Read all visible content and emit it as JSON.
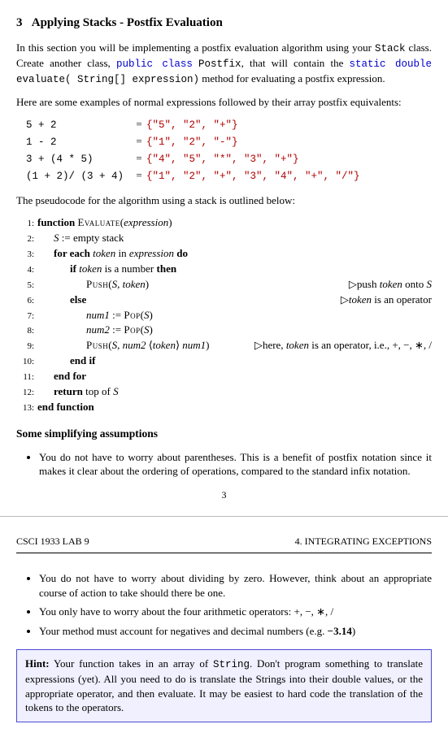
{
  "section": {
    "number": "3",
    "title": "Applying Stacks - Postfix Evaluation"
  },
  "intro": {
    "p1a": "In this section you will be implementing a postfix evaluation algorithm using your ",
    "stack": "Stack",
    "p1b": " class. Create another class, ",
    "kw_public_class": "public class",
    "postfix": "Postfix",
    "p1c": ", that will contain the ",
    "kw_static_double": "static double",
    "evaluate": "evaluate( String[] expression)",
    "p1d": " method for evaluating a postfix expression.",
    "p2": "Here are some examples of normal expressions followed by their array postfix equivalents:"
  },
  "examples": [
    {
      "lhs": "5 + 2",
      "rhs": "{\"5\", \"2\", \"+\"}"
    },
    {
      "lhs": "1 - 2",
      "rhs": "{\"1\", \"2\", \"-\"}"
    },
    {
      "lhs": "3 + (4 * 5)",
      "rhs": "{\"4\", \"5\", \"*\", \"3\", \"+\"}"
    },
    {
      "lhs": "(1 + 2)/ (3 + 4)",
      "rhs": "{\"1\", \"2\", \"+\", \"3\", \"4\", \"+\", \"/\"}"
    }
  ],
  "pseudo_lead": "The pseudocode for the algorithm using a stack is outlined below:",
  "algo": {
    "fn_kw": "function",
    "fn_name": "Evaluate",
    "fn_arg": "expression",
    "l2a": "S",
    "l2b": " := empty stack",
    "l3a": "for each ",
    "l3b": "token",
    "l3c": " in ",
    "l3d": "expression",
    "l3e": " do",
    "l4a": "if ",
    "l4b": "token",
    "l4c": " is a number ",
    "l4d": "then",
    "l5_call": "Push",
    "l5_args": "(S, token)",
    "l5_comment": "push token onto S",
    "l6": "else",
    "l6_comment": "token is an operator",
    "l7a": "num1",
    "l7b": " := ",
    "pop": "Pop",
    "pop_args": "(S)",
    "l8a": "num2",
    "l9_args": "(S, num2 ⟨token⟩ num1)",
    "l9_comment": "here, token is an operator, i.e., +, −, ∗, /",
    "l10": "end if",
    "l11": "end for",
    "l12a": "return",
    "l12b": " top of S",
    "l13": "end function"
  },
  "assumptions_title": "Some simplifying assumptions",
  "bullets_p1": [
    "You do not have to worry about parentheses. This is a benefit of postfix notation since it makes it clear about the ordering of operations, compared to the standard infix notation."
  ],
  "page_number": "3",
  "runhead_left": "CSCI 1933 LAB 9",
  "runhead_right": "4. INTEGRATING EXCEPTIONS",
  "bullets_p2": {
    "b1": "You do not have to worry about dividing by zero. However, think about an appropriate course of action to take should there be one.",
    "b2": "You only have to worry about the four arithmetic operators: +, −, ∗, /",
    "b3a": "Your method must account for negatives and decimal numbers (e.g. ",
    "b3b": "−3.14",
    "b3c": ")"
  },
  "hint": {
    "label": "Hint:",
    "t1": " Your function takes in an array of ",
    "string": "String",
    "t2": ". Don't program something to translate expressions (yet). All you need to do is translate the Strings into their double values, or the appropriate operator, and then evaluate. It may be easiest to hard code the translation of the tokens to the operators."
  }
}
